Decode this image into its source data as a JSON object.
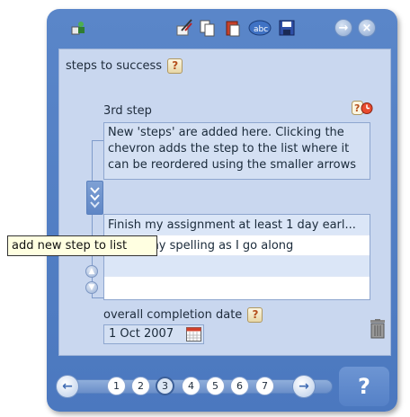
{
  "panel": {
    "title": "steps to success",
    "step_label": "3rd step",
    "step_description": "New 'steps' are added here. Clicking the chevron adds the step to the list where it can be reordered using the smaller arrows",
    "steps_list": [
      "Finish my assignment at least 1 day earl...",
      "Check my spelling as I go along",
      "",
      ""
    ],
    "tooltip": "add new step to list",
    "completion_label": "overall completion date",
    "completion_date": "1 Oct 2007"
  },
  "help_badge": "?",
  "pager": {
    "pages": [
      "1",
      "2",
      "3",
      "4",
      "5",
      "6",
      "7"
    ],
    "current_page": "3",
    "help_label": "?"
  },
  "icons": {
    "toolbar": [
      "people-icon",
      "cut-icon",
      "copy-icon",
      "paste-icon",
      "spellcheck-icon",
      "save-icon",
      "forward-icon",
      "close-icon"
    ],
    "panel": [
      "help-icon",
      "clock-help-icon",
      "chevron-down-icon",
      "arrow-up-icon",
      "arrow-down-icon",
      "calendar-icon",
      "trash-icon"
    ]
  },
  "colors": {
    "frame": "#5a86c9",
    "panel": "#c9d7ef",
    "tooltip_bg": "#ffffe1",
    "selected_row": "#dbe6f7"
  }
}
